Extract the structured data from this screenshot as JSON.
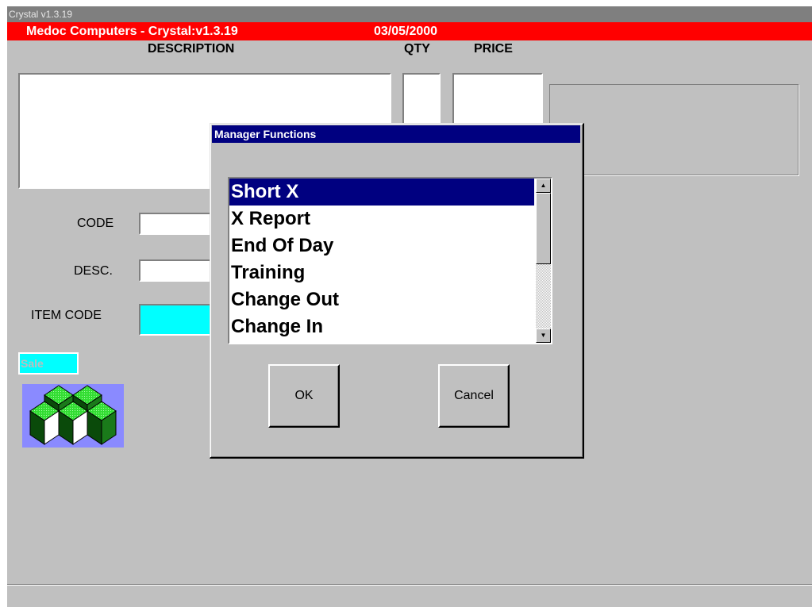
{
  "window": {
    "title": "Crystal v1.3.19"
  },
  "header": {
    "title": "Medoc Computers - Crystal:v1.3.19",
    "date": "03/05/2000"
  },
  "columns": {
    "description": "DESCRIPTION",
    "qty": "QTY",
    "price": "PRICE"
  },
  "form": {
    "code_label": "CODE",
    "code_value": "",
    "desc_label": "DESC.",
    "desc_value": "",
    "item_code_label": "ITEM CODE",
    "item_code_value": ""
  },
  "mode": {
    "label": "Sale"
  },
  "dialog": {
    "title": "Manager Functions",
    "items": [
      "Short X",
      "X Report",
      "End Of Day",
      "Training",
      "Change Out",
      "Change In"
    ],
    "selected_index": 0,
    "ok_label": "OK",
    "cancel_label": "Cancel"
  },
  "colors": {
    "header_bar": "#ff0000",
    "dialog_title": "#000080",
    "selection": "#000080",
    "item_code_field": "#00ffff",
    "logo_background": "#8a8aff",
    "logo_cube": "#44ee44"
  },
  "icons": {
    "logo": "green-cubes-logo",
    "scroll_up": "up-arrow-icon",
    "scroll_down": "down-arrow-icon"
  }
}
